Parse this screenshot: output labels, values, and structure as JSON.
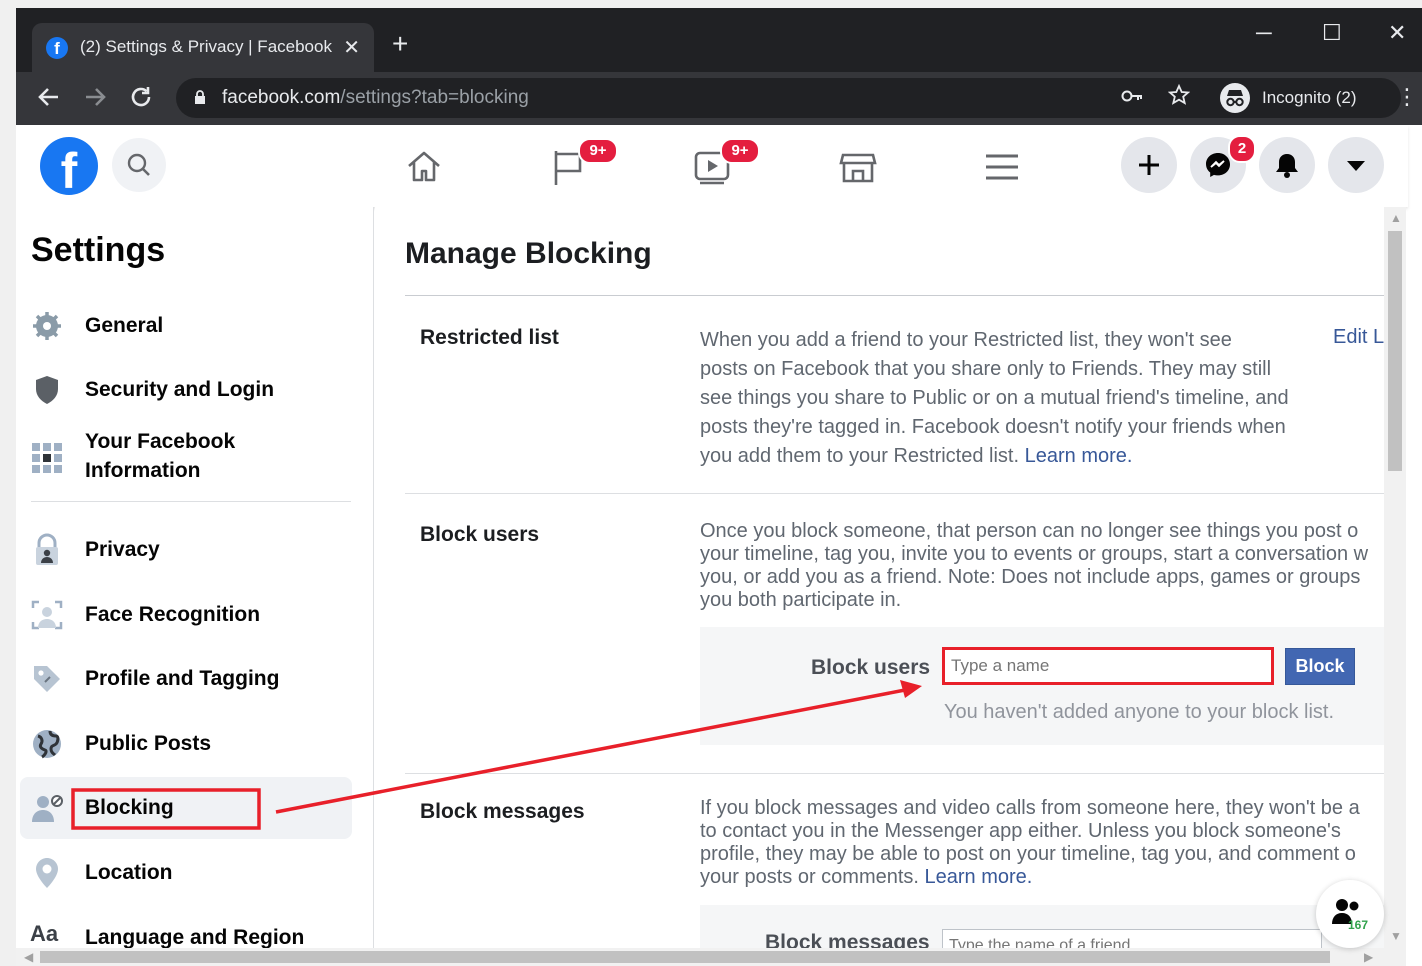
{
  "browser": {
    "tab_title": "(2) Settings & Privacy | Facebook",
    "tab_favicon": "f",
    "tab_close": "✕",
    "new_tab": "+",
    "window_controls": [
      "─",
      "☐",
      "✕"
    ],
    "url_host": "facebook.com",
    "url_path": "/settings?tab=blocking",
    "incognito_label": "Incognito (2)",
    "menu": "⋮"
  },
  "fb_header": {
    "logo_letter": "f",
    "pages_badge": "9+",
    "watch_badge": "9+",
    "messenger_badge": "2"
  },
  "sidebar": {
    "title": "Settings",
    "items": [
      {
        "label": "General",
        "icon": "gear-icon"
      },
      {
        "label": "Security and Login",
        "icon": "shield-icon"
      },
      {
        "label": "Your Facebook Information",
        "icon": "grid-icon"
      },
      {
        "label": "Privacy",
        "icon": "lock-person-icon"
      },
      {
        "label": "Face Recognition",
        "icon": "face-scan-icon"
      },
      {
        "label": "Profile and Tagging",
        "icon": "tag-icon"
      },
      {
        "label": "Public Posts",
        "icon": "globe-icon"
      },
      {
        "label": "Blocking",
        "icon": "block-user-icon"
      },
      {
        "label": "Location",
        "icon": "location-pin-icon"
      },
      {
        "label": "Language and Region",
        "icon": "aa-icon"
      }
    ],
    "active": "Blocking"
  },
  "main": {
    "title": "Manage Blocking",
    "restricted": {
      "label": "Restricted list",
      "lines": [
        "When you add a friend to your Restricted list, they won't see",
        "posts on Facebook that you share only to Friends. They may still",
        "see things you share to Public or on a mutual friend's timeline, and",
        "posts they're tagged in. Facebook doesn't notify your friends when",
        "you add them to your Restricted list."
      ],
      "learn_more": "Learn more.",
      "edit_link": "Edit L"
    },
    "block_users": {
      "label": "Block users",
      "lines": [
        "Once you block someone, that person can no longer see things you post o",
        "your timeline, tag you, invite you to events or groups, start a conversation w",
        "you, or add you as a friend. Note: Does not include apps, games or groups",
        "you both participate in."
      ],
      "field_label": "Block users",
      "input_placeholder": "Type a name",
      "button": "Block",
      "empty_note": "You haven't added anyone to your block list."
    },
    "block_messages": {
      "label": "Block messages",
      "lines": [
        "If you block messages and video calls from someone here, they won't be a",
        "to contact you in the Messenger app either. Unless you block someone's",
        "profile, they may be able to post on your timeline, tag you, and comment o",
        "your posts or comments."
      ],
      "learn_more": "Learn more.",
      "field_label": "Block messages",
      "input_placeholder": "Type the name of a friend"
    }
  },
  "contacts_count": "167",
  "colors": {
    "fb_blue": "#1877f2",
    "link": "#385898",
    "button": "#4267b2",
    "annotation_red": "#e8202a",
    "badge_red": "#e41e3f"
  }
}
